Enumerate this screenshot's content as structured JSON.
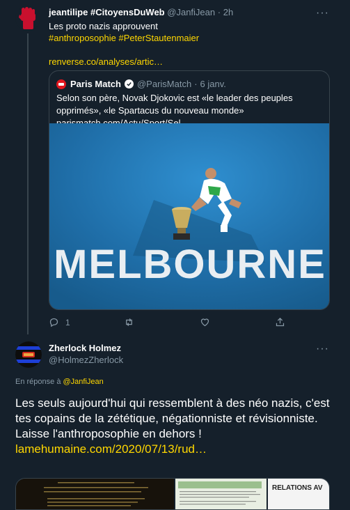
{
  "tweet1": {
    "name": "jeantilipe #CitoyensDuWeb",
    "handle": "@JanfiJean",
    "dot": "·",
    "time": "2h",
    "text_line1": "Les proto nazis approuvent",
    "hashtag1": "#anthroposophie",
    "hashtag2": "#PeterStautenmaier",
    "link": "renverse.co/analyses/artic…",
    "more": "···"
  },
  "quote": {
    "name": "Paris Match",
    "handle": "@ParisMatch",
    "dot": "·",
    "date": "6 janv.",
    "text": "Selon son père, Novak Djokovic est «le leader des peuples opprimés», «le Spartacus du nouveau monde» parismatch.com/Actu/Sport/Sel…",
    "image_word": "MELBOURNE"
  },
  "actions": {
    "reply_count": "1",
    "retweet_count": "",
    "like_count": ""
  },
  "tweet2": {
    "name": "Zherlock Holmez",
    "handle": "@HolmezZherlock",
    "more": "···",
    "reply_prefix": "En réponse à",
    "reply_mention": "@JanfiJean",
    "line1": "Les seuls aujourd'hui qui ressemblent à des néo nazis, c'est tes copains de la zététique, négationniste et révisionniste.",
    "line2": "Laisse l'anthroposophie en dehors !",
    "link": "lamehumaine.com/2020/07/13/rud…",
    "media_caption": "RELATIONS AV"
  },
  "colors": {
    "background": "#15202b",
    "accent": "#ffd700",
    "muted": "#8899a6",
    "border": "#38444d"
  },
  "icons": [
    "raised-fist-icon",
    "more-icon",
    "verified-icon",
    "reply-icon",
    "retweet-icon",
    "like-icon",
    "share-icon"
  ]
}
